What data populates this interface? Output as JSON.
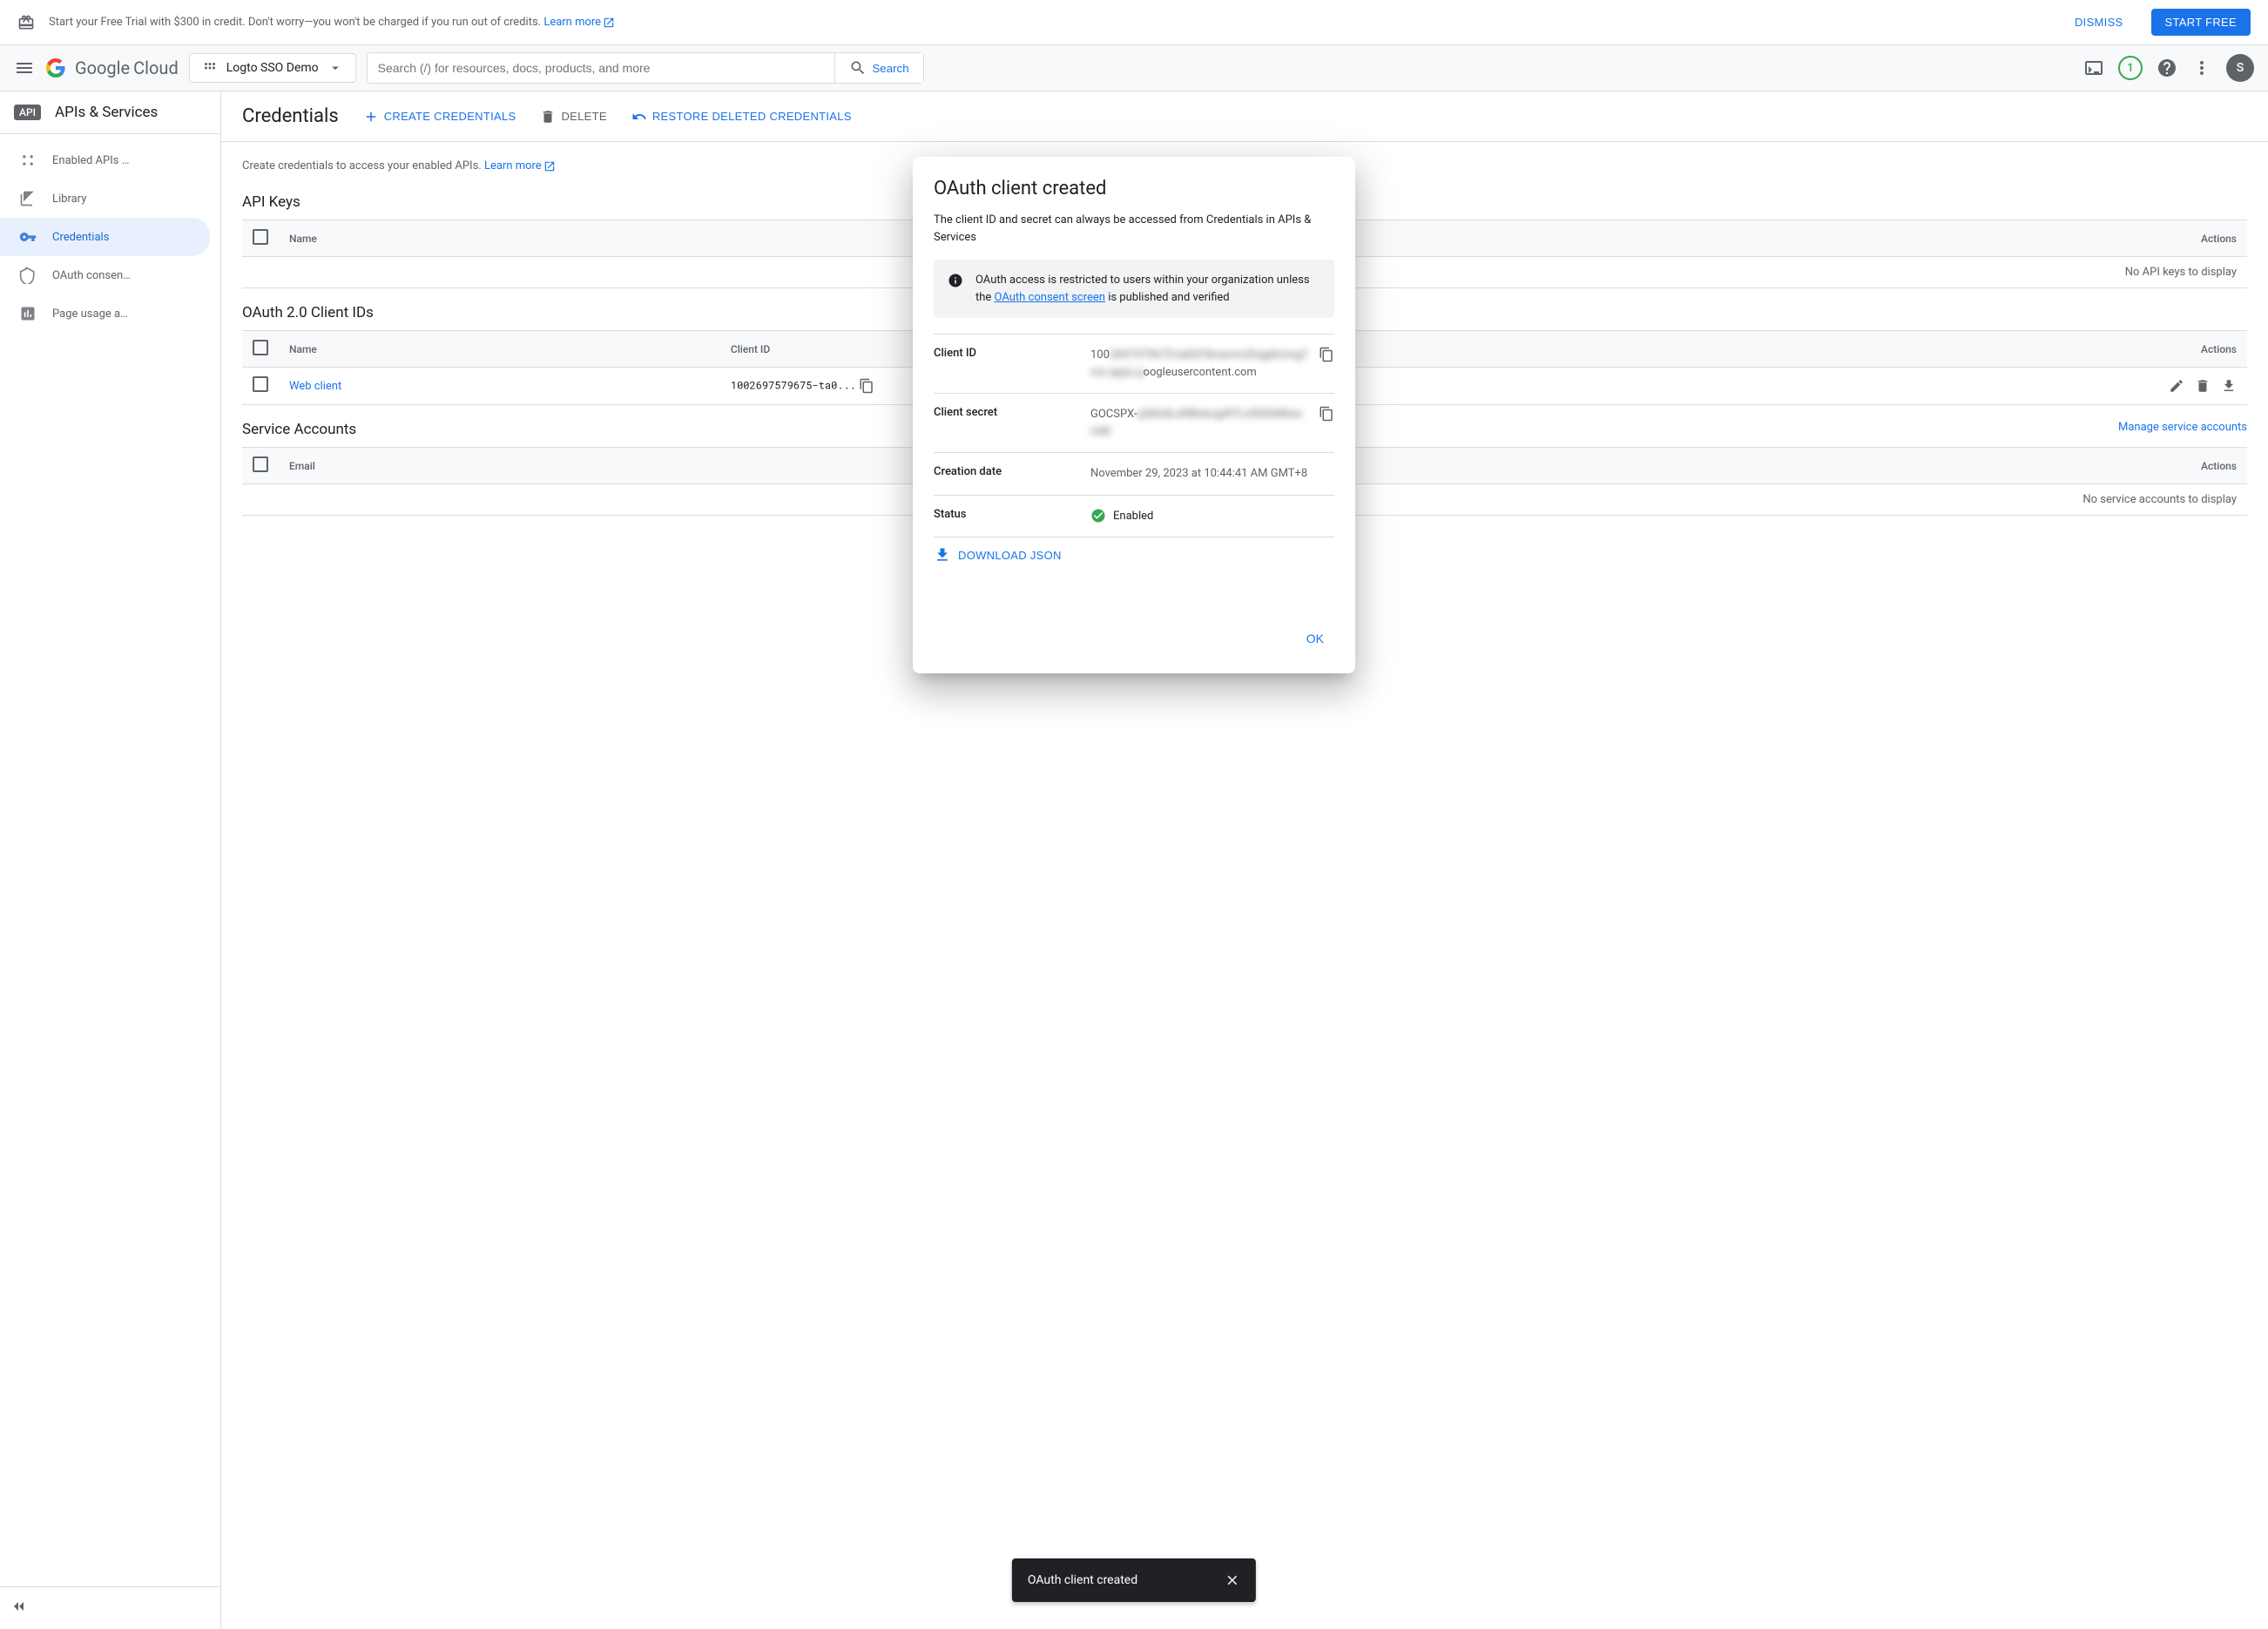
{
  "banner": {
    "text": "Start your Free Trial with $300 in credit. Don't worry—you won't be charged if you run out of credits. ",
    "learn_more": "Learn more",
    "dismiss": "DISMISS",
    "start_free": "START FREE"
  },
  "header": {
    "logo_cloud": "Cloud",
    "project": "Logto SSO Demo",
    "search_placeholder": "Search (/) for resources, docs, products, and more",
    "search_label": "Search",
    "badge": "1",
    "avatar": "S"
  },
  "sidebar": {
    "badge": "API",
    "title": "APIs & Services",
    "items": [
      {
        "label": "Enabled APIs …"
      },
      {
        "label": "Library"
      },
      {
        "label": "Credentials"
      },
      {
        "label": "OAuth consen…"
      },
      {
        "label": "Page usage a…"
      }
    ]
  },
  "toolbar": {
    "title": "Credentials",
    "create": "CREATE CREDENTIALS",
    "delete": "DELETE",
    "restore": "RESTORE DELETED CREDENTIALS"
  },
  "intro": {
    "text": "Create credentials to access your enabled APIs. ",
    "learn_more": "Learn more"
  },
  "sections": {
    "api_keys": {
      "title": "API Keys",
      "cols": {
        "name": "Name",
        "actions": "Actions"
      },
      "empty": "No API keys to display"
    },
    "oauth": {
      "title": "OAuth 2.0 Client IDs",
      "cols": {
        "name": "Name",
        "client_id": "Client ID",
        "actions": "Actions"
      },
      "rows": [
        {
          "name": "Web client",
          "client_id": "1002697579675-ta0..."
        }
      ]
    },
    "service": {
      "title": "Service Accounts",
      "manage": "Manage service accounts",
      "cols": {
        "email": "Email",
        "actions": "Actions"
      },
      "empty": "No service accounts to display"
    }
  },
  "modal": {
    "title": "OAuth client created",
    "subtitle": "The client ID and secret can always be accessed from Credentials in APIs & Services",
    "info_pre": "OAuth access is restricted to users within your organization unless the ",
    "info_link": "OAuth consent screen",
    "info_post": " is published and verified",
    "fields": {
      "client_id_label": "Client ID",
      "client_id_prefix": "100",
      "client_id_blurred": "2697579675-ta0d7ibvevrm2hqg0cimg7rox.apps.g",
      "client_id_suffix": "oogleusercontent.com",
      "secret_label": "Client secret",
      "secret_prefix": "GOCSPX-",
      "secret_blurred": "q3kDdLvKBhdcqyR7Lx5hEkMtxwmM",
      "date_label": "Creation date",
      "date_value": "November 29, 2023 at 10:44:41 AM GMT+8",
      "status_label": "Status",
      "status_value": "Enabled"
    },
    "download": "DOWNLOAD JSON",
    "ok": "OK"
  },
  "toast": {
    "text": "OAuth client created"
  }
}
